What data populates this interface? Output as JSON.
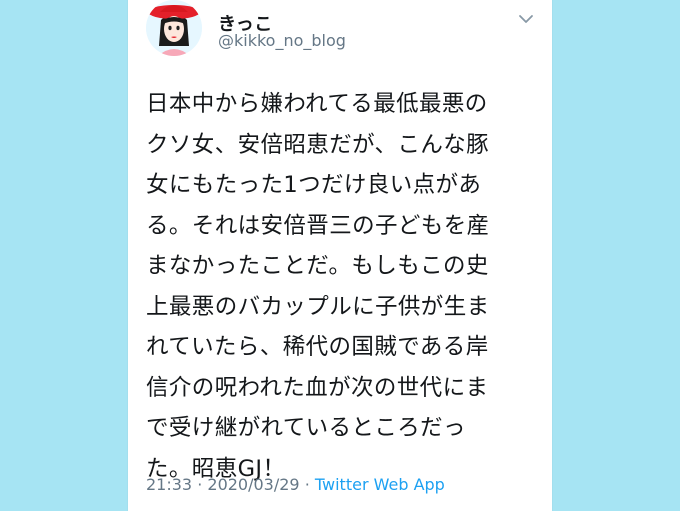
{
  "tweet": {
    "user_name": "きっこ",
    "handle": "@kikko_no_blog",
    "lines": [
      "日本中から嫌われてる最低最悪の",
      "クソ女、安倍昭恵だが、こんな豚",
      "女にもたった1つだけ良い点があ",
      "る。それは安倍晋三の子どもを産",
      "まなかったことだ。もしもこの史",
      "上最悪のバカップルに子供が生ま",
      "れていたら、稀代の国賊である岸",
      "信介の呪われた血が次の世代にま",
      "で受け継がれているところだっ",
      "た。昭恵GJ！"
    ],
    "time": "21:33",
    "date": "2020/03/29",
    "separator": "·",
    "source": "Twitter Web App",
    "menu_icon": "chevron-down-icon"
  },
  "colors": {
    "background": "#a6e4f3",
    "card": "#ffffff",
    "text": "#14171a",
    "muted": "#657786",
    "link": "#1da1f2"
  }
}
